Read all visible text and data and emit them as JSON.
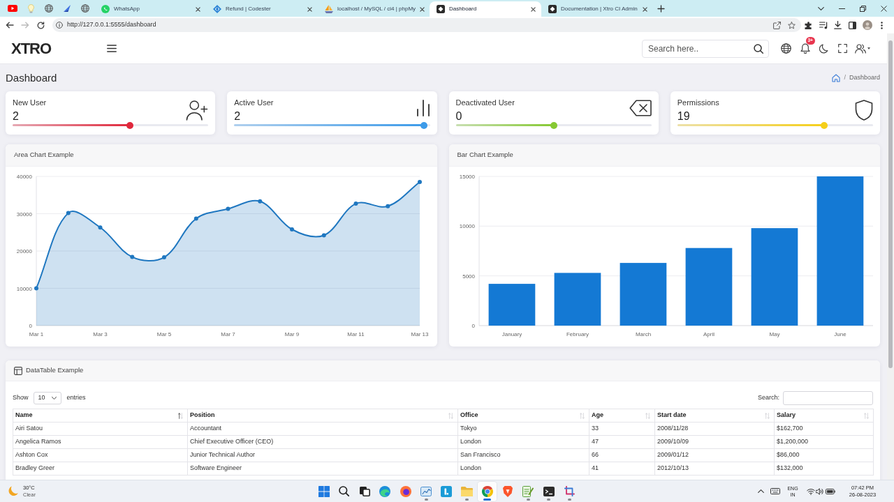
{
  "browser": {
    "tabs": [
      {
        "title": "WhatsApp",
        "selected": false
      },
      {
        "title": "Refund | Codester",
        "selected": false
      },
      {
        "title": "localhost / MySQL / ci4 | phpMy",
        "selected": false
      },
      {
        "title": "Dashboard",
        "selected": true
      },
      {
        "title": "Documentation | Xtro CI Admin",
        "selected": false
      }
    ],
    "back": {
      "disabled": false
    },
    "forward": {
      "disabled": true
    },
    "url": "http://127.0.0.1:5555/dashboard"
  },
  "header": {
    "logo": "XTRO",
    "search": {
      "placeholder": "Search here.."
    },
    "notifications": {
      "badge": "3+"
    }
  },
  "page": {
    "title": "Dashboard",
    "breadcrumb": {
      "separator": "/",
      "items": [
        "Dashboard"
      ]
    }
  },
  "stats": [
    {
      "label": "New User",
      "value": "2",
      "level": 0.6,
      "color": "#e0283c"
    },
    {
      "label": "Active User",
      "value": "2",
      "level": 0.97,
      "color": "#3d9be9"
    },
    {
      "label": "Deactivated User",
      "value": "0",
      "level": 0.5,
      "color": "#86c933"
    },
    {
      "label": "Permissions",
      "value": "19",
      "level": 0.75,
      "color": "#f5cf1a"
    }
  ],
  "area_chart": {
    "title": "Area Chart Example",
    "chart_data": {
      "type": "area",
      "categories": [
        "Mar 1",
        null,
        "Mar 3",
        null,
        "Mar 5",
        null,
        "Mar 7",
        null,
        "Mar 9",
        null,
        "Mar 11",
        null,
        "Mar 13"
      ],
      "values": [
        10000,
        30200,
        26300,
        18400,
        18300,
        28700,
        31300,
        33300,
        25800,
        24200,
        32700,
        32000,
        38500
      ],
      "color": "#1f77c0",
      "yticks": [
        0,
        10000,
        20000,
        30000,
        40000
      ],
      "ylim": [
        0,
        40000
      ],
      "grid": true,
      "marker": "circle"
    }
  },
  "bar_chart": {
    "title": "Bar Chart Example",
    "chart_data": {
      "type": "bar",
      "categories": [
        "January",
        "February",
        "March",
        "April",
        "May",
        "June"
      ],
      "values": [
        4200,
        5300,
        6300,
        7800,
        9800,
        15000
      ],
      "color": "#1479d4",
      "yticks": [
        0,
        5000,
        10000,
        15000
      ],
      "ylim": [
        0,
        15000
      ],
      "grid": true
    }
  },
  "datatable": {
    "title": "DataTable Example",
    "length": {
      "before": "Show",
      "value": "10",
      "after": "entries"
    },
    "search_label": "Search:",
    "columns": [
      {
        "label": "Name",
        "sorted": true
      },
      {
        "label": "Position",
        "sorted": false
      },
      {
        "label": "Office",
        "sorted": false
      },
      {
        "label": "Age",
        "sorted": false
      },
      {
        "label": "Start date",
        "sorted": false
      },
      {
        "label": "Salary",
        "sorted": false
      }
    ],
    "rows": [
      [
        "Airi Satou",
        "Accountant",
        "Tokyo",
        "33",
        "2008/11/28",
        "$162,700"
      ],
      [
        "Angelica Ramos",
        "Chief Executive Officer (CEO)",
        "London",
        "47",
        "2009/10/09",
        "$1,200,000"
      ],
      [
        "Ashton Cox",
        "Junior Technical Author",
        "San Francisco",
        "66",
        "2009/01/12",
        "$86,000"
      ],
      [
        "Bradley Greer",
        "Software Engineer",
        "London",
        "41",
        "2012/10/13",
        "$132,000"
      ]
    ]
  },
  "taskbar": {
    "weather": {
      "temperature": "30°C",
      "condition": "Clear"
    },
    "items": [
      {
        "running": false,
        "selected": false
      },
      {
        "running": false,
        "selected": false
      },
      {
        "running": false,
        "selected": false
      },
      {
        "running": false,
        "selected": false
      },
      {
        "running": false,
        "selected": false
      },
      {
        "running": true,
        "selected": false
      },
      {
        "running": false,
        "selected": false
      },
      {
        "running": true,
        "selected": false
      },
      {
        "running": true,
        "selected": true
      },
      {
        "running": false,
        "selected": false
      },
      {
        "running": true,
        "selected": false
      },
      {
        "running": true,
        "selected": false
      },
      {
        "running": true,
        "selected": false
      }
    ],
    "language": "ENG",
    "region": "IN",
    "time": "07:42 PM",
    "date": "26-08-2023"
  }
}
